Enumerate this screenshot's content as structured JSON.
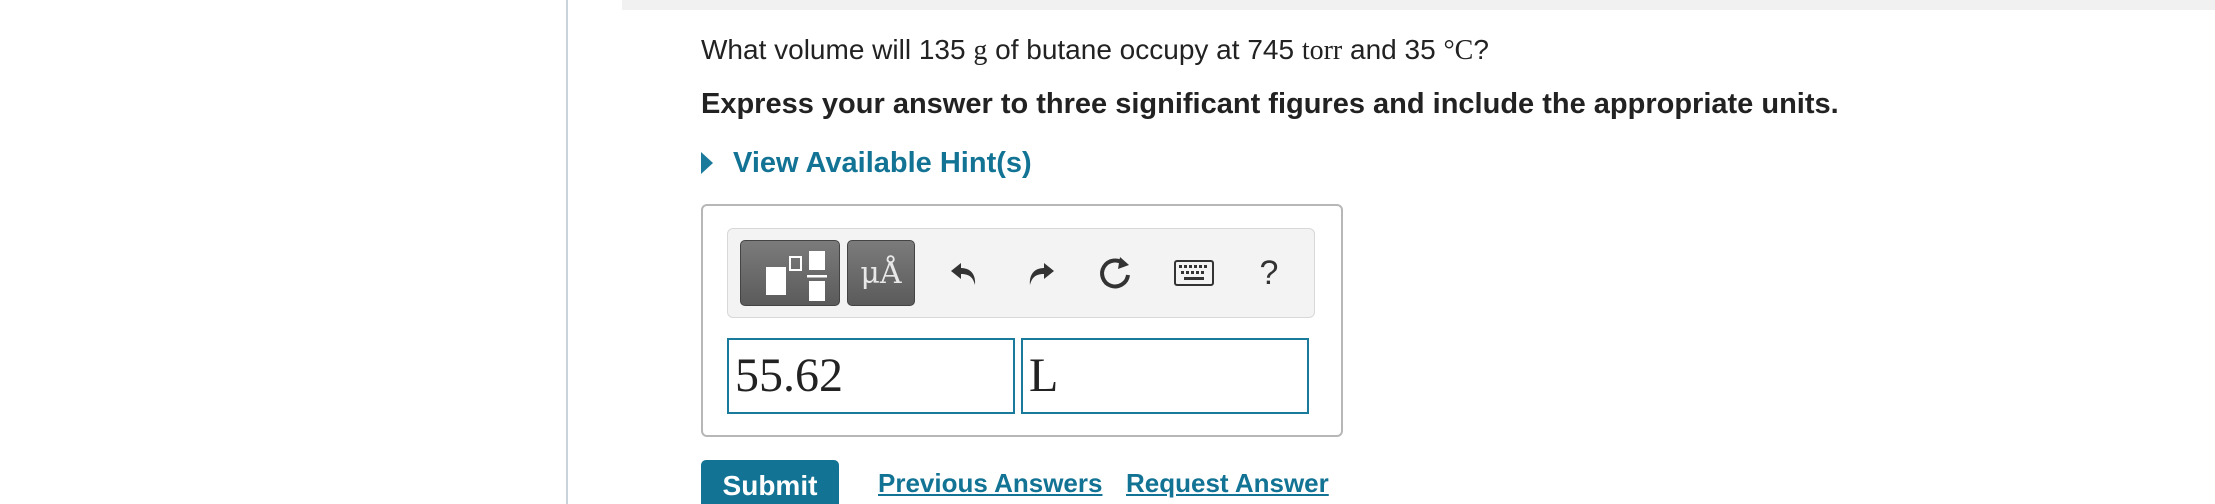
{
  "question": {
    "prefix": "What volume will ",
    "mass_value": "135",
    "mass_unit": "g",
    "mid": " of butane occupy at ",
    "pressure_value": "745",
    "pressure_unit": "torr",
    "and": " and ",
    "temp_value": "35",
    "temp_unit": "°C",
    "suffix": "?"
  },
  "instruction": "Express your answer to three significant figures and include the appropriate units.",
  "hint": {
    "label": "View Available Hint(s)"
  },
  "toolbar": {
    "templates_icon": "templates-icon",
    "units_label": "μÅ",
    "undo_icon": "undo-icon",
    "redo_icon": "redo-icon",
    "reset_icon": "reset-icon",
    "keyboard_icon": "keyboard-icon",
    "help_label": "?"
  },
  "answer": {
    "value": "55.62",
    "unit": "L"
  },
  "actions": {
    "submit_label": "Submit",
    "previous_answers_label": "Previous Answers",
    "request_answer_label": "Request Answer"
  },
  "colors": {
    "accent": "#137394",
    "panel_border": "#b7b7b7",
    "toolbar_bg": "#f3f3f3"
  }
}
